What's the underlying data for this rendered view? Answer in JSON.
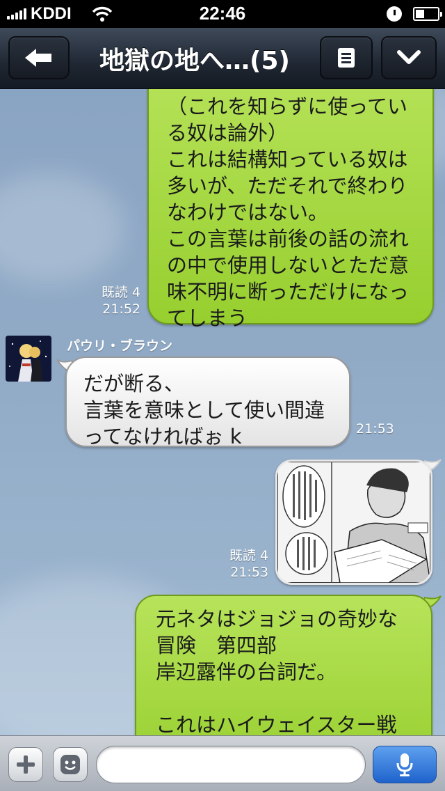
{
  "status_bar": {
    "carrier": "KDDI",
    "time": "22:46"
  },
  "nav": {
    "title": "地獄の地へ…(5)",
    "back_icon": "back-arrow-icon",
    "menu_icon": "list-icon",
    "more_icon": "chevron-down-icon"
  },
  "messages": [
    {
      "side": "right",
      "lines": [
        "（これを知らずに使ってい",
        "る奴は論外）",
        "これは結構知っている奴は",
        "多いが、ただそれで終わり",
        "なわけではない。",
        "この言葉は前後の話の流れ",
        "の中で使用しないとただ意",
        "味不明に断っただけになっ",
        "てしまう"
      ],
      "read": "既読 4",
      "time": "21:52"
    },
    {
      "side": "left",
      "sender": "パウリ・ブラウン",
      "lines": [
        "だが断る、",
        "言葉を意味として使い間違",
        "ってなければぉ k"
      ],
      "time": "21:53"
    },
    {
      "side": "right",
      "type": "image",
      "read": "既読 4",
      "time": "21:53"
    },
    {
      "side": "right",
      "lines": [
        "元ネタはジョジョの奇妙な",
        "冒険　第四部",
        "岸辺露伴の台詞だ。",
        "",
        "これはハイウェイスター戦"
      ]
    }
  ],
  "input": {
    "placeholder": "",
    "plus_icon": "plus-icon",
    "emoji_icon": "emoji-icon",
    "mic_icon": "microphone-icon"
  },
  "colors": {
    "green_bubble": "#a8da47",
    "white_bubble": "#f4f4f4",
    "nav_bg": "#1f2733",
    "chat_bg": "#90aac6",
    "mic_button": "#2f78dd"
  }
}
